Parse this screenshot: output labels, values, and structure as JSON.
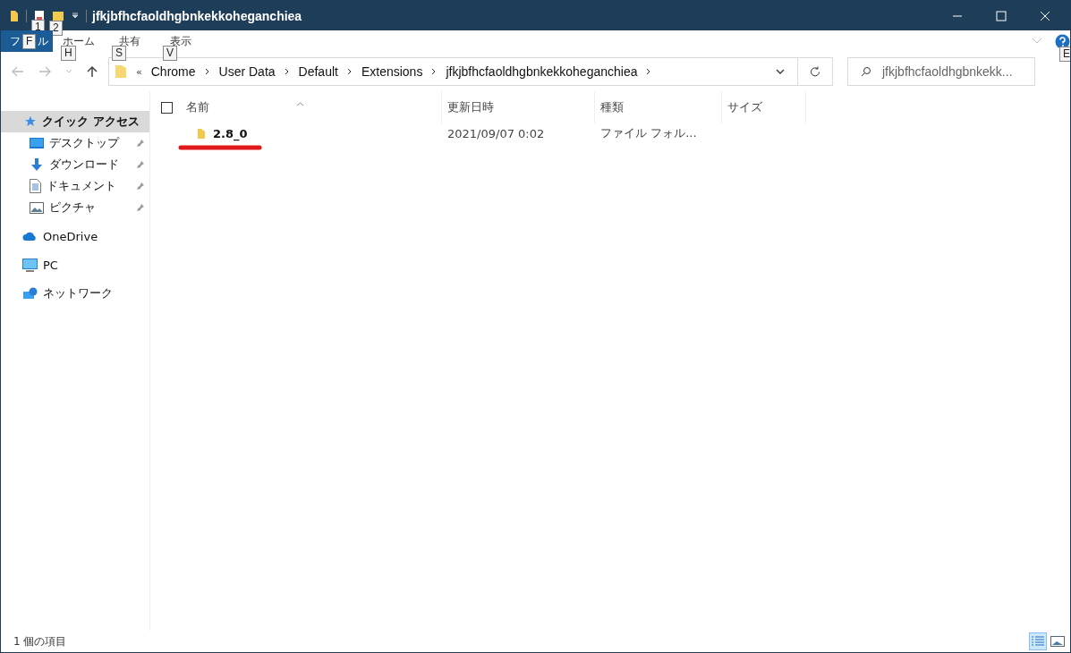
{
  "window": {
    "title": "jfkjbfhcfaoldhgbnkekkoheganchiea",
    "quick_access_keytips": [
      "1",
      "2"
    ]
  },
  "ribbon": {
    "file_tab": {
      "label_start": "フ",
      "label_end": "ル",
      "keytip": "F"
    },
    "tabs": [
      {
        "label": "ホーム",
        "keytip": "H"
      },
      {
        "label": "共有",
        "keytip": "S"
      },
      {
        "label": "表示",
        "keytip": "V"
      }
    ],
    "help_keytip": "E"
  },
  "address_bar": {
    "overflow": "«",
    "crumbs": [
      "Chrome",
      "User Data",
      "Default",
      "Extensions",
      "jfkjbfhcfaoldhgbnkekkoheganchiea"
    ]
  },
  "search": {
    "placeholder": "jfkjbfhcfaoldhgbnkekk..."
  },
  "sidebar": {
    "items": [
      {
        "kind": "quick",
        "label": "クイック アクセス",
        "selected": true,
        "pinned": false
      },
      {
        "kind": "desktop",
        "label": "デスクトップ",
        "selected": false,
        "pinned": true
      },
      {
        "kind": "download",
        "label": "ダウンロード",
        "selected": false,
        "pinned": true
      },
      {
        "kind": "document",
        "label": "ドキュメント",
        "selected": false,
        "pinned": true
      },
      {
        "kind": "picture",
        "label": "ピクチャ",
        "selected": false,
        "pinned": true
      },
      {
        "kind": "onedrive",
        "label": "OneDrive",
        "selected": false,
        "pinned": false
      },
      {
        "kind": "pc",
        "label": "PC",
        "selected": false,
        "pinned": false
      },
      {
        "kind": "network",
        "label": "ネットワーク",
        "selected": false,
        "pinned": false
      }
    ]
  },
  "table": {
    "select_all_checked": false,
    "columns": [
      "名前",
      "更新日時",
      "種類",
      "サイズ"
    ],
    "rows": [
      {
        "name": "2.8_0",
        "modified": "2021/09/07 0:02",
        "type": "ファイル フォル...",
        "selected": false
      }
    ]
  },
  "status_bar": {
    "text": "1 個の項目"
  }
}
